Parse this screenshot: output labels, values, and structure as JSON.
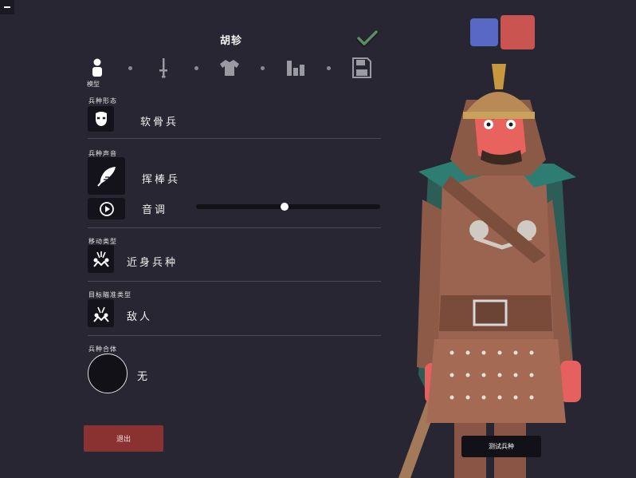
{
  "unit": {
    "name": "胡轸"
  },
  "tabs": [
    {
      "id": "model",
      "label": "模型",
      "icon": "person-icon",
      "active": true
    },
    {
      "id": "weapon",
      "icon": "sword-icon"
    },
    {
      "id": "armor",
      "icon": "shirt-icon"
    },
    {
      "id": "stats",
      "icon": "bar-chart-icon"
    },
    {
      "id": "save",
      "icon": "save-icon"
    }
  ],
  "sections": {
    "form": {
      "label": "兵种形态",
      "value": "软骨兵",
      "icon": "mask-icon"
    },
    "voice": {
      "label": "兵种声音",
      "value": "挥棒兵",
      "icon": "feather-icon",
      "pitch_label": "音调",
      "pitch_level": 0.48,
      "play_icon": "play-icon"
    },
    "movement": {
      "label": "移动类型",
      "value": "近身兵种",
      "icon": "melee-units-icon"
    },
    "targeting": {
      "label": "目标瞄准类型",
      "value": "敌人",
      "icon": "melee-target-icon"
    },
    "body": {
      "label": "兵种合体",
      "value": "无"
    }
  },
  "buttons": {
    "exit": "退出",
    "test": "测试兵种"
  },
  "colors": {
    "team_blue": "#5967c5",
    "team_red": "#c95450",
    "exit_bg": "#8a3232",
    "bg": "#272632"
  },
  "icons": {
    "confirm": "checkmark-icon",
    "menu": "menu-icon"
  }
}
